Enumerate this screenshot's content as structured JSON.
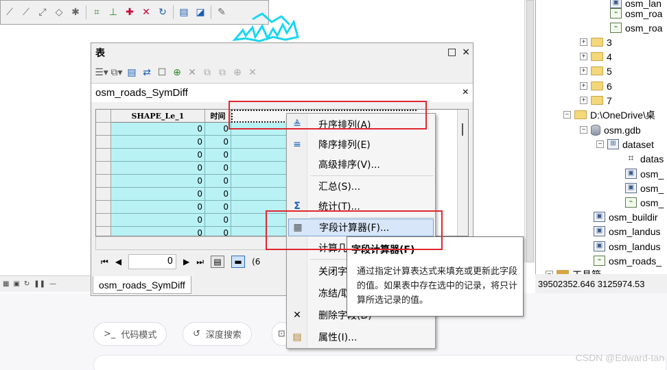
{
  "table_window": {
    "title": "表",
    "max_glyph": "□",
    "close_glyph": "×",
    "tab_name": "osm_roads_SymDiff",
    "tab_close_glyph": "×",
    "columns": [
      "SHAPE_Le_1",
      "时间",
      ""
    ],
    "row_values": [
      [
        "0",
        "0"
      ],
      [
        "0",
        "0"
      ],
      [
        "0",
        "0"
      ],
      [
        "0",
        "0"
      ],
      [
        "0",
        "0"
      ],
      [
        "0",
        "0"
      ],
      [
        "0",
        "0"
      ],
      [
        "0",
        "0"
      ],
      [
        "0",
        "0"
      ]
    ],
    "nav": {
      "first": "⏮",
      "prev": "◀",
      "record": "0",
      "next": "▶",
      "last": "⏭",
      "count_prefix": "(6"
    },
    "bottom_tab": "osm_roads_SymDiff"
  },
  "context_menu": {
    "items": [
      {
        "label": "升序排列(A)",
        "icon": "sort-ascending-icon"
      },
      {
        "label": "降序排列(E)",
        "icon": "sort-descending-icon"
      },
      {
        "label": "高级排序(V)...",
        "icon": ""
      },
      {
        "label": "汇总(S)...",
        "icon": ""
      },
      {
        "label": "统计(T)...",
        "icon": "sigma-icon"
      },
      {
        "label": "字段计算器(F)...",
        "icon": "calculator-icon"
      },
      {
        "label": "计算几",
        "icon": ""
      },
      {
        "label": "关闭字",
        "icon": ""
      },
      {
        "label": "冻结/取",
        "icon": ""
      },
      {
        "label": "删除字段(D)",
        "icon": "delete-icon"
      },
      {
        "label": "属性(I)...",
        "icon": "properties-icon"
      }
    ]
  },
  "tooltip": {
    "title": "字段计算器(F)",
    "body": "通过指定计算表达式来填充或更新此字段的值。如果表中存在选中的记录，将只计算所选记录的值。"
  },
  "catalog_tree": {
    "nodes": [
      {
        "label": "osm_lan",
        "type": "polygon"
      },
      {
        "label": "osm_roa",
        "type": "line"
      },
      {
        "label": "osm_roa",
        "type": "line"
      },
      {
        "label": "3",
        "type": "folder"
      },
      {
        "label": "4",
        "type": "folder"
      },
      {
        "label": "5",
        "type": "folder"
      },
      {
        "label": "6",
        "type": "folder"
      },
      {
        "label": "7",
        "type": "folder"
      },
      {
        "label": "D:\\OneDrive\\桌",
        "type": "folder"
      },
      {
        "label": "osm.gdb",
        "type": "database"
      },
      {
        "label": "dataset",
        "type": "dataset"
      },
      {
        "label": "datas",
        "type": "topology"
      },
      {
        "label": "osm_",
        "type": "polygon"
      },
      {
        "label": "osm_",
        "type": "polygon"
      },
      {
        "label": "osm_",
        "type": "line"
      },
      {
        "label": "osm_buildir",
        "type": "polygon"
      },
      {
        "label": "osm_landus",
        "type": "polygon"
      },
      {
        "label": "osm_landus",
        "type": "polygon"
      },
      {
        "label": "osm_roads_",
        "type": "line"
      },
      {
        "label": "工具箱",
        "type": "toolbox"
      }
    ],
    "coordinates": "39502352.646  3125974.53"
  },
  "lower_bar": {
    "code_mode": "代码模式",
    "deep_search": "深度搜索",
    "watermark": "CSDN @Edward-tan"
  },
  "colors": {
    "highlight_red": "#e0252e",
    "cell_cyan": "#b8f2f5",
    "menu_highlight": "#d7e6f8"
  }
}
